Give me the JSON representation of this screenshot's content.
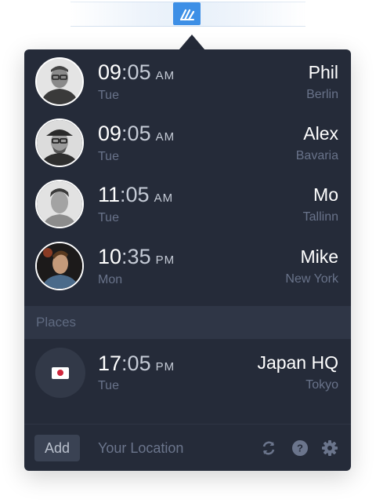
{
  "app": {
    "tray_icon": "timezone-app-icon"
  },
  "people": [
    {
      "time_hour": "09",
      "time_min": ":05",
      "ampm": "AM",
      "day": "Tue",
      "name": "Phil",
      "city": "Berlin",
      "avatar": "avatar-phil"
    },
    {
      "time_hour": "09",
      "time_min": ":05",
      "ampm": "AM",
      "day": "Tue",
      "name": "Alex",
      "city": "Bavaria",
      "avatar": "avatar-alex"
    },
    {
      "time_hour": "11",
      "time_min": ":05",
      "ampm": "AM",
      "day": "Tue",
      "name": "Mo",
      "city": "Tallinn",
      "avatar": "avatar-mo"
    },
    {
      "time_hour": "10",
      "time_min": ":35",
      "ampm": "PM",
      "day": "Mon",
      "name": "Mike",
      "city": "New York",
      "avatar": "avatar-mike"
    }
  ],
  "places_section": {
    "title": "Places"
  },
  "places": [
    {
      "time_hour": "17",
      "time_min": ":05",
      "ampm": "PM",
      "day": "Tue",
      "name": "Japan HQ",
      "city": "Tokyo",
      "icon": "japan-flag-icon"
    }
  ],
  "footer": {
    "add_label": "Add",
    "location_placeholder": "Your Location",
    "icons": [
      "refresh-icon",
      "help-icon",
      "settings-icon"
    ]
  },
  "colors": {
    "panel_bg": "#252b39",
    "accent": "#3d8fe6",
    "muted_text": "#69738a"
  }
}
